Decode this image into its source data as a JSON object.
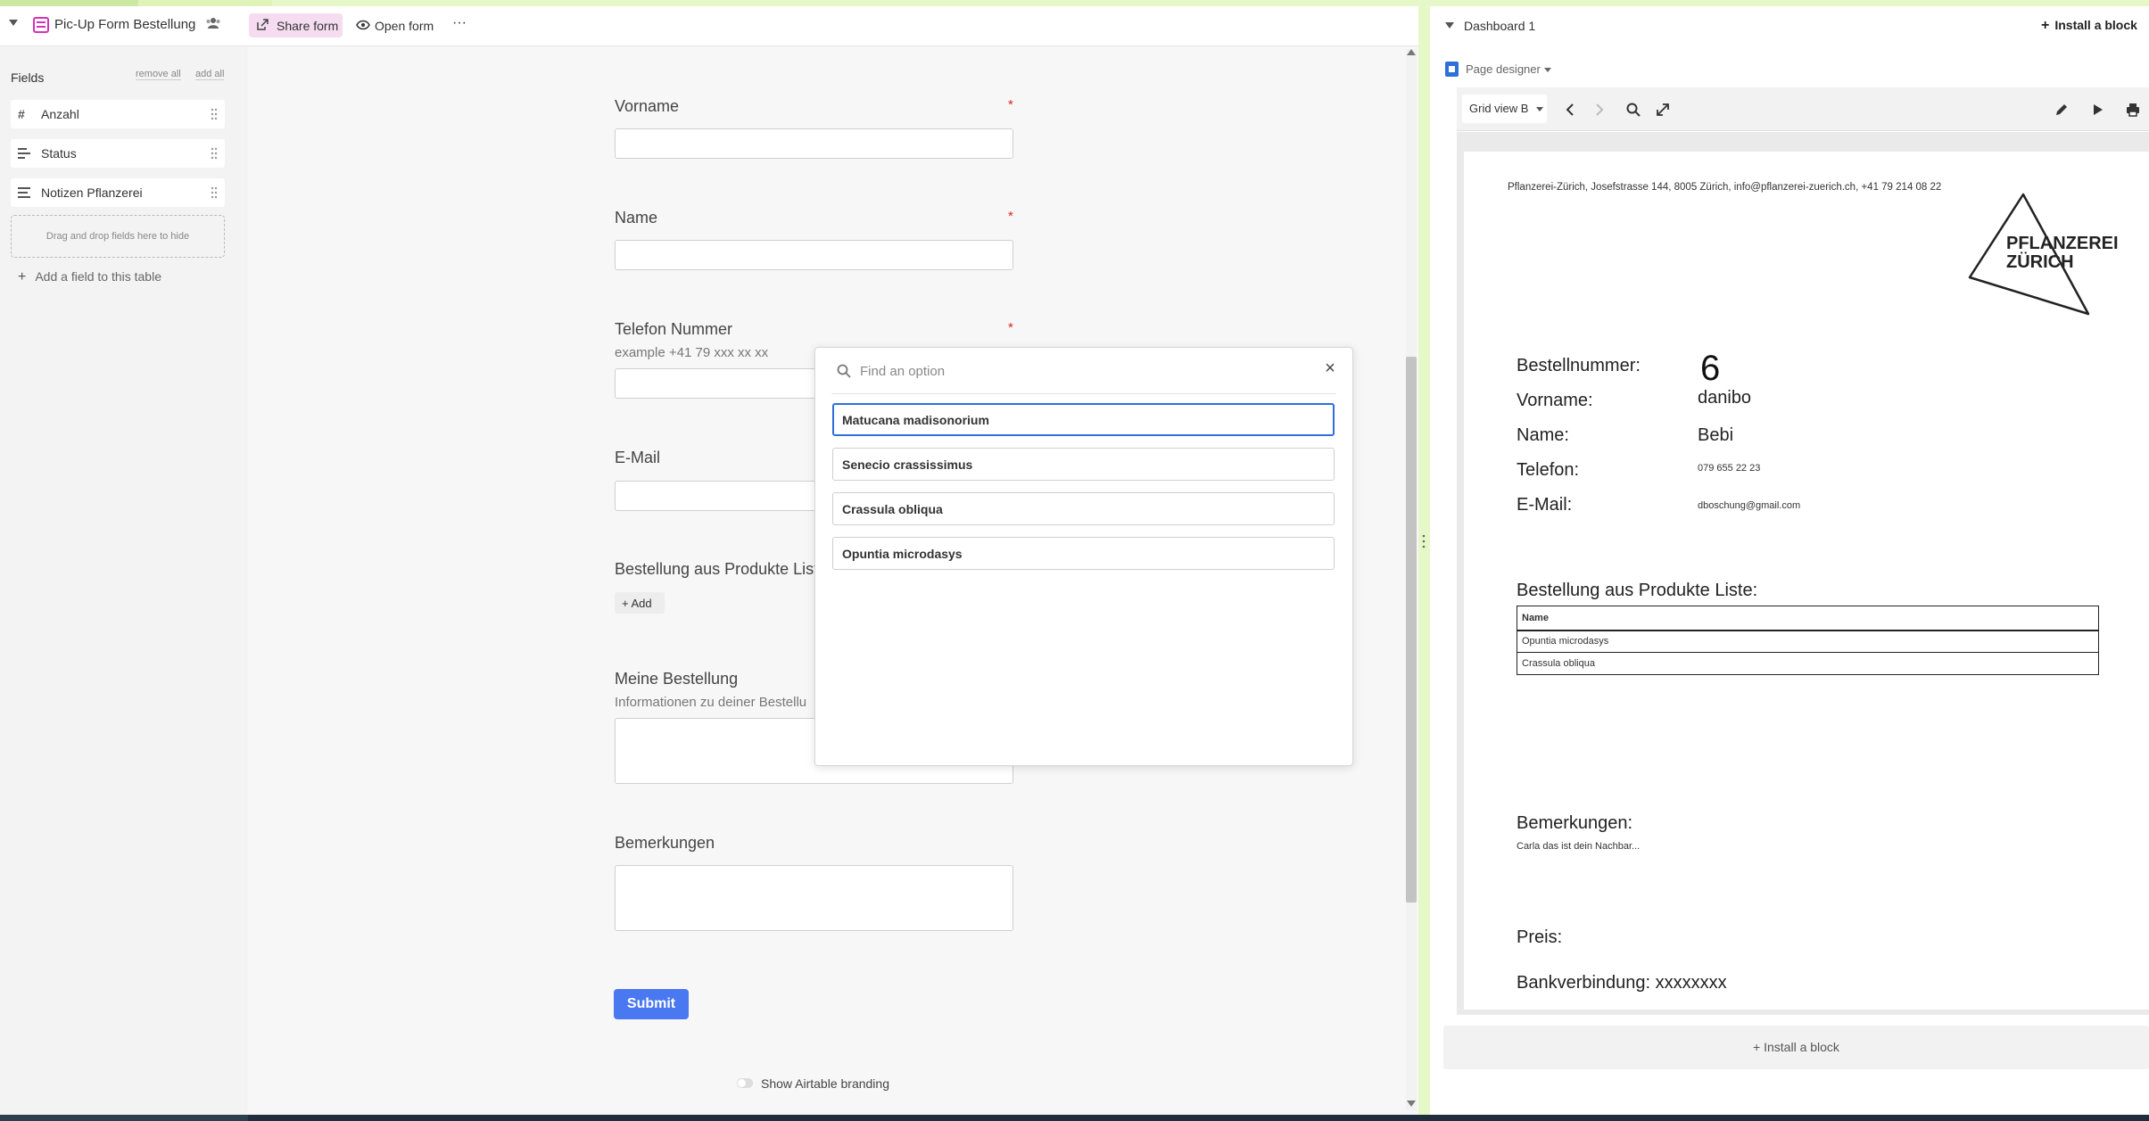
{
  "left": {
    "view_title": "Pic-Up Form Bestellung",
    "share_label": "Share form",
    "open_label": "Open form",
    "more_label": "···",
    "fields_title": "Fields",
    "remove_all": "remove all",
    "add_all": "add all",
    "fields": [
      {
        "label": "Anzahl",
        "icon": "number-icon"
      },
      {
        "label": "Status",
        "icon": "single-select-icon"
      },
      {
        "label": "Notizen Pflanzerei",
        "icon": "long-text-icon"
      }
    ],
    "dropzone": "Drag and drop fields here to hide",
    "add_field": "Add a field to this table"
  },
  "form": {
    "vorname": "Vorname",
    "name": "Name",
    "telefon": "Telefon Nummer",
    "telefon_desc": "example +41 79 xxx xx xx",
    "email": "E-Mail",
    "bestellung": "Bestellung aus Produkte Liste",
    "add_label": "+ Add",
    "meine": "Meine Bestellung",
    "meine_desc": "Informationen zu deiner Bestellu",
    "bemerkungen": "Bemerkungen",
    "required_mark": "*",
    "submit": "Submit",
    "branding": "Show Airtable branding"
  },
  "popup": {
    "placeholder": "Find an option",
    "close": "×",
    "options": [
      "Matucana madisonorium",
      "Senecio crassissimus",
      "Crassula obliqua",
      "Opuntia microdasys"
    ]
  },
  "right": {
    "dashboard_title": "Dashboard 1",
    "install_top": "Install a block",
    "page_designer": "Page designer",
    "grid_view": "Grid view B",
    "install_bottom": "+ Install a block",
    "page": {
      "address": "Pflanzerei-Zürich, Josefstrasse 144, 8005 Zürich, info@pflanzerei-zuerich.ch,  +41 79 214 08 22",
      "logo_line1": "PFLANZEREI",
      "logo_line2": "ZÜRICH",
      "bestellnummer_label": "Bestellnummer:",
      "bestellnummer": "6",
      "vorname_label": "Vorname:",
      "vorname": "danibo",
      "name_label": "Name:",
      "name": "Bebi",
      "telefon_label": "Telefon:",
      "telefon": "079 655 22 23",
      "email_label": "E-Mail:",
      "email": "dboschung@gmail.com",
      "bestellung_label": "Bestellung aus Produkte Liste:",
      "table_header": "Name",
      "table_rows": [
        "Opuntia microdasys",
        "Crassula obliqua"
      ],
      "bemerkungen_label": "Bemerkungen:",
      "bemerkungen": "Carla das ist dein Nachbar...",
      "preis_label": "Preis:",
      "bank": "Bankverbindung: xxxxxxxx"
    }
  },
  "colors": {
    "accent_blue": "#4a78f0",
    "form_icon": "#d531b8",
    "share_bg": "#f5dcf0",
    "green_strip": "#e7f8c8"
  }
}
